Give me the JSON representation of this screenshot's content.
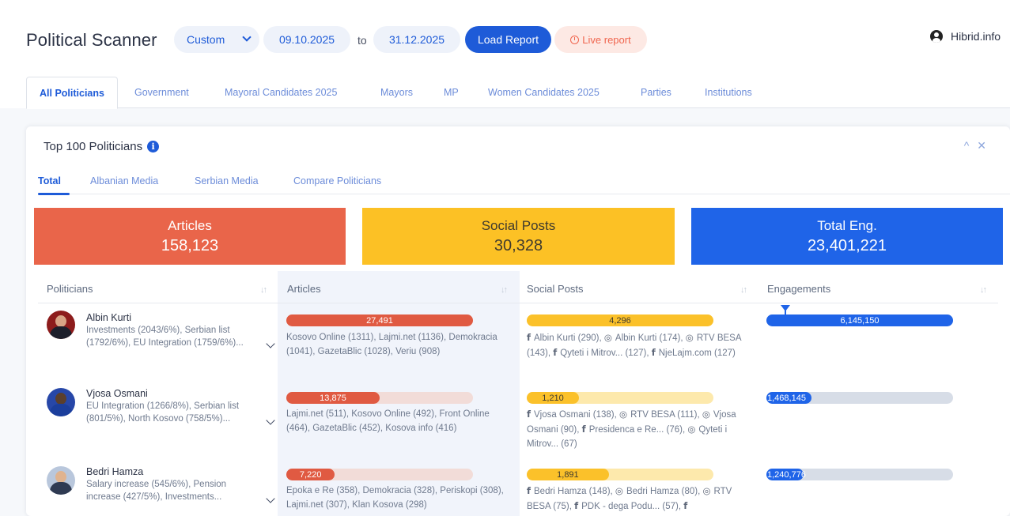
{
  "header": {
    "title": "Political Scanner",
    "range_select": "Custom",
    "date_from": "09.10.2025",
    "to_label": "to",
    "date_to": "31.12.2025",
    "load_button": "Load Report",
    "live_button": "Live report",
    "user_name": "Hibrid.info"
  },
  "category_tabs": [
    "All Politicians",
    "Government",
    "Mayoral Candidates 2025",
    "Mayors",
    "MP",
    "Women Candidates 2025",
    "Parties",
    "Institutions"
  ],
  "active_category": "All Politicians",
  "panel": {
    "title": "Top 100 Politicians",
    "info_icon": "i",
    "controls": {
      "collapse": "^",
      "close": "✕"
    },
    "sub_tabs": [
      "Total",
      "Albanian Media",
      "Serbian Media",
      "Compare Politicians"
    ],
    "active_sub_tab": "Total"
  },
  "stats": {
    "articles": {
      "label": "Articles",
      "value": "158,123",
      "color": "#e9654a"
    },
    "social": {
      "label": "Social Posts",
      "value": "30,328",
      "color": "#fcc125"
    },
    "engagement": {
      "label": "Total Eng.",
      "value": "23,401,221",
      "color": "#1f64e8"
    }
  },
  "table": {
    "columns": [
      "Politicians",
      "Articles",
      "Social Posts",
      "Engagements"
    ],
    "sort_icon": "↓↑",
    "rows": [
      {
        "name": "Albin Kurti",
        "topics": "Investments (2043/6%), Serbian list (1792/6%), EU Integration (1759/6%)...",
        "articles": {
          "value": "27,491",
          "fraction": 1.0
        },
        "articles_sources": "Kosovo Online (1311), Lajmi.net (1136), Demokracia (1041), GazetaBlic (1028), Veriu (908)",
        "social": {
          "value": "4,296",
          "fraction": 1.0
        },
        "social_sources": [
          {
            "icon": "f",
            "text": "Albin Kurti (290), "
          },
          {
            "icon": "◎",
            "text": "Albin Kurti (174), "
          },
          {
            "icon": "◎",
            "text": "RTV BESA (143), "
          },
          {
            "icon": "f",
            "text": "Qyteti i Mitrov... (127), "
          },
          {
            "icon": "f",
            "text": "NjeLajm.com (127)"
          }
        ],
        "engagement": {
          "value": "6,145,150",
          "fraction": 1.0
        }
      },
      {
        "name": "Vjosa Osmani",
        "topics": "EU Integration (1266/8%), Serbian list (801/5%), North Kosovo (758/5%)...",
        "articles": {
          "value": "13,875",
          "fraction": 0.5
        },
        "articles_sources": "Lajmi.net (511), Kosovo Online (492), Front Online (464), GazetaBlic (452), Kosova info (416)",
        "social": {
          "value": "1,210",
          "fraction": 0.28
        },
        "social_sources": [
          {
            "icon": "f",
            "text": "Vjosa Osmani (138), "
          },
          {
            "icon": "◎",
            "text": "RTV BESA (111), "
          },
          {
            "icon": "◎",
            "text": "Vjosa Osmani (90), "
          },
          {
            "icon": "f",
            "text": "Presidenca e Re... (76), "
          },
          {
            "icon": "◎",
            "text": "Qyteti i Mitrov... (67)"
          }
        ],
        "engagement": {
          "value": "1,468,145",
          "fraction": 0.24
        }
      },
      {
        "name": "Bedri Hamza",
        "topics": "Salary increase (545/6%), Pension increase (427/5%), Investments...",
        "articles": {
          "value": "7,220",
          "fraction": 0.26
        },
        "articles_sources": "Epoka e Re (358), Demokracia (328), Periskopi (308), Lajmi.net (307), Klan Kosova (298)",
        "social": {
          "value": "1,891",
          "fraction": 0.44
        },
        "social_sources": [
          {
            "icon": "f",
            "text": "Bedri Hamza (148), "
          },
          {
            "icon": "◎",
            "text": "Bedri Hamza (80), "
          },
          {
            "icon": "◎",
            "text": "RTV BESA (75), "
          },
          {
            "icon": "f",
            "text": "PDK - dega Podu... (57), "
          },
          {
            "icon": "f",
            "text": ""
          }
        ],
        "engagement": {
          "value": "1,240,776",
          "fraction": 0.2
        }
      }
    ]
  }
}
